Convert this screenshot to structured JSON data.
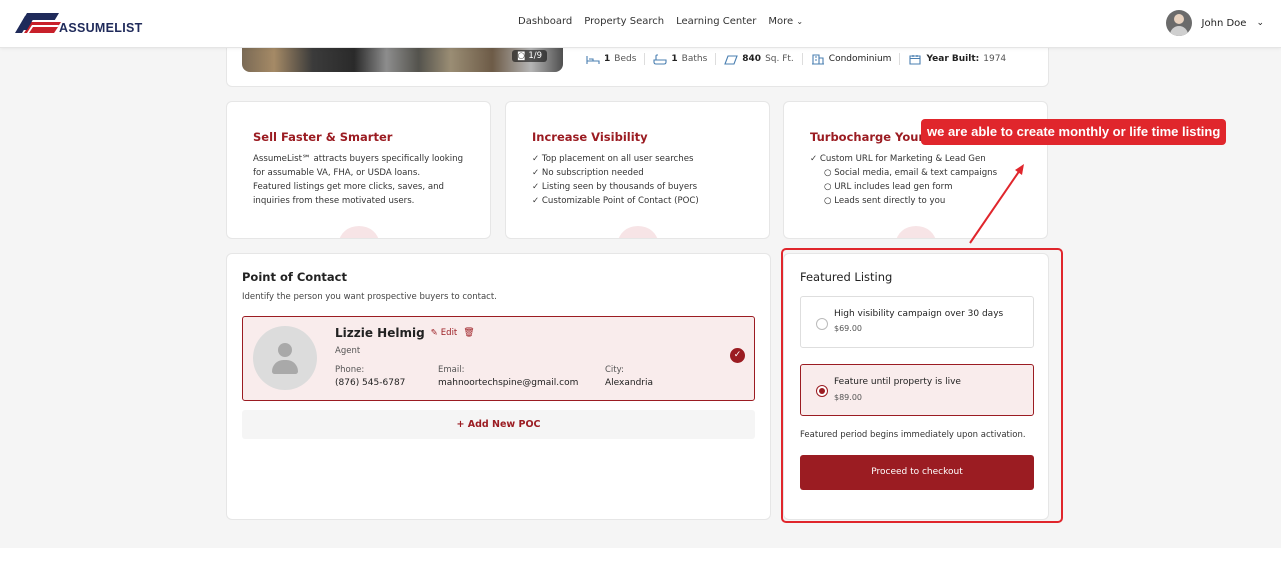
{
  "header": {
    "logo_text": "ASSUMELIST",
    "nav": [
      "Dashboard",
      "Property Search",
      "Learning Center",
      "More"
    ],
    "user_name": "John Doe"
  },
  "property": {
    "photo_counter": "1/9",
    "beds_value": "1",
    "beds_label": "Beds",
    "baths_value": "1",
    "baths_label": "Baths",
    "sqft_value": "840",
    "sqft_label": "Sq. Ft.",
    "type": "Condominium",
    "year_label": "Year Built:",
    "year_value": "1974"
  },
  "benefits": [
    {
      "title": "Sell Faster & Smarter",
      "lines": [
        "AssumeList℠ attracts buyers specifically looking",
        "for assumable VA, FHA, or USDA loans.",
        "Featured listings get more clicks, saves, and",
        "inquiries from these motivated users."
      ]
    },
    {
      "title": "Increase Visibility",
      "lines": [
        "✓ Top placement on all user searches",
        "✓ No subscription needed",
        "✓ Listing seen by thousands of buyers",
        "✓ Customizable Point of Contact (POC)"
      ]
    },
    {
      "title": "Turbocharge Your Reach",
      "lines": [
        "✓ Custom URL for Marketing & Lead Gen",
        "○ Social media, email & text campaigns",
        "○ URL includes lead gen form",
        "○ Leads sent directly to you"
      ]
    }
  ],
  "poc": {
    "title": "Point of Contact",
    "hint": "Identify the person you want prospective buyers to contact.",
    "name": "Lizzie Helmig",
    "edit_label": "Edit",
    "role": "Agent",
    "phone_label": "Phone:",
    "phone": "(876) 545-6787",
    "email_label": "Email:",
    "email": "mahnoortechspine@gmail.com",
    "city_label": "City:",
    "city": "Alexandria",
    "add_label": "+ Add New POC"
  },
  "featured": {
    "title": "Featured Listing",
    "options": [
      {
        "title": "High visibility campaign over 30 days",
        "price": "$69.00",
        "selected": false
      },
      {
        "title": "Feature until property is live",
        "price": "$89.00",
        "selected": true
      }
    ],
    "note": "Featured period begins immediately upon activation.",
    "checkout_label": "Proceed to checkout"
  },
  "annotation": {
    "text": "we are able to create monthly or life time listing",
    "color": "#e0262c"
  },
  "colors": {
    "brand": "#9b1c22",
    "brand_light": "#f9ecec",
    "navy": "#1f2a5a"
  }
}
